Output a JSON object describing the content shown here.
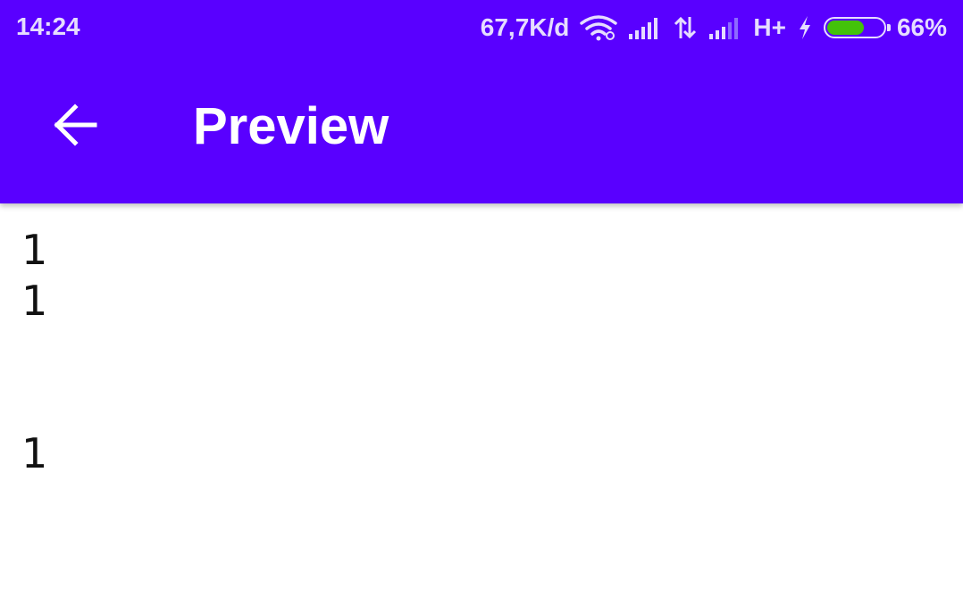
{
  "status_bar": {
    "time": "14:24",
    "network_speed": "67,7K/d",
    "network_type": "H+",
    "battery_percent": "66%",
    "battery_level": 0.66,
    "icons": [
      "wifi-icon",
      "signal-icon",
      "data-transfer-icon",
      "signal-icon",
      "charging-icon",
      "battery-icon"
    ]
  },
  "toolbar": {
    "title": "Preview",
    "back_icon": "arrow-left-icon"
  },
  "content": {
    "lines": [
      "1",
      "1",
      "1"
    ]
  },
  "colors": {
    "primary": "#5900ff",
    "status_text": "#e6dcff",
    "battery": "#43c20a",
    "background": "#ffffff",
    "text": "#111111"
  }
}
